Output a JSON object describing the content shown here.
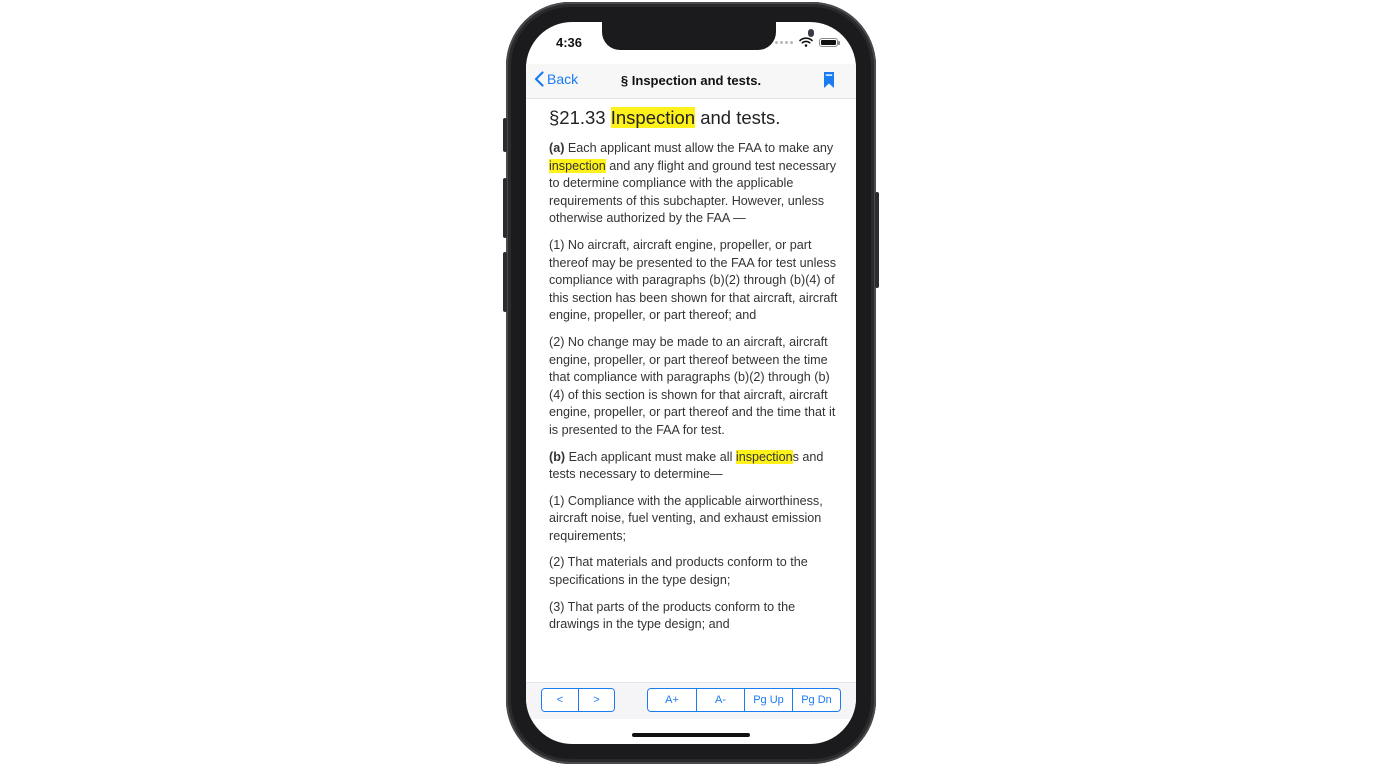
{
  "status": {
    "time": "4:36"
  },
  "navbar": {
    "back_label": "Back",
    "title": "§ Inspection and tests."
  },
  "doc": {
    "heading": {
      "prefix": "§21.33 ",
      "highlight": "Inspection",
      "suffix": " and tests."
    },
    "para_a": {
      "label": "(a)",
      "text1": " Each applicant must allow the FAA to make any ",
      "highlight": "inspection",
      "text2": " and any flight and ground test necessary to determine compliance with the applicable requirements of this subchapter. However, unless otherwise authorized by the FAA —"
    },
    "para_a1": "(1) No aircraft, aircraft engine, propeller, or part thereof may be presented to the FAA for test unless compliance with paragraphs (b)(2) through (b)(4) of this section has been shown for that aircraft, aircraft engine, propeller, or part thereof; and",
    "para_a2": "(2) No change may be made to an aircraft, aircraft engine, propeller, or part thereof between the time that compliance with paragraphs (b)(2) through (b)(4) of this section is shown for that aircraft, aircraft engine, propeller, or part thereof and the time that it is presented to the FAA for test.",
    "para_b": {
      "label": "(b)",
      "text1": " Each applicant must make all ",
      "highlight": "inspection",
      "text2": "s and tests necessary to determine—"
    },
    "para_b1": "(1) Compliance with the applicable airworthiness, aircraft noise, fuel venting, and exhaust emission requirements;",
    "para_b2": "(2) That materials and products conform to the specifications in the type design;",
    "para_b3": "(3) That parts of the products conform to the drawings in the type design; and"
  },
  "toolbar": {
    "prev": "<",
    "next": ">",
    "font_up": "A+",
    "font_down": "A-",
    "page_up": "Pg Up",
    "page_down": "Pg Dn"
  },
  "colors": {
    "accent": "#1a7cf2",
    "highlight": "#fff21a"
  }
}
